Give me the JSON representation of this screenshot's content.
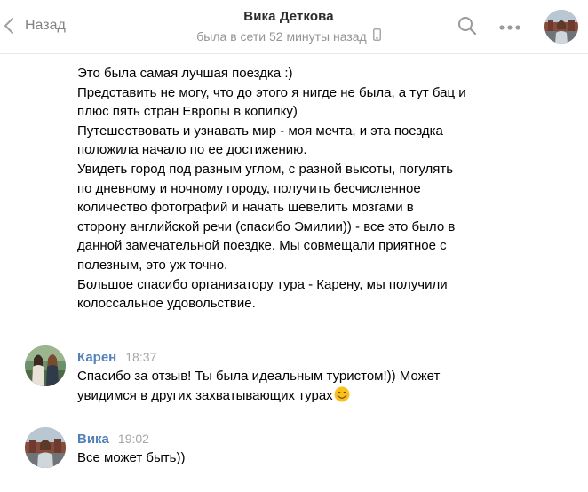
{
  "header": {
    "back_label": "Назад",
    "contact_name": "Вика Деткова",
    "status": "была в сети 52 минуты назад"
  },
  "messages": [
    {
      "lines": [
        "Это была самая лучшая поездка :)",
        "Представить не могу, что до этого я нигде не была, а тут бац и",
        "плюс пять стран Европы в копилку)",
        "Путешествовать и узнавать мир - моя мечта, и эта поездка",
        "положила начало по ее достижению.",
        "Увидеть город под разным углом, с разной высоты, погулять",
        "по дневному и ночному городу, получить бесчисленное",
        "количество фотографий и начать шевелить мозгами в",
        "сторону английской речи (спасибо Эмилии)) - все это было в",
        "данной замечательной поездке. Мы совмещали приятное с",
        "полезным, это уж точно.",
        "Большое спасибо организатору тура - Карену, мы получили",
        "колоссальное удовольствие."
      ]
    },
    {
      "author": "Карен",
      "time": "18:37",
      "lines": [
        "Спасибо за отзыв! Ты была идеальным туристом!)) Может",
        "увидимся в других захватывающих турах"
      ],
      "emoji": "smiling-face-emoji"
    },
    {
      "author": "Вика",
      "time": "19:02",
      "lines": [
        "Все может быть))"
      ]
    }
  ],
  "colors": {
    "author_link": "#5181b8",
    "muted": "#939393",
    "divider": "#e7e8ec"
  }
}
